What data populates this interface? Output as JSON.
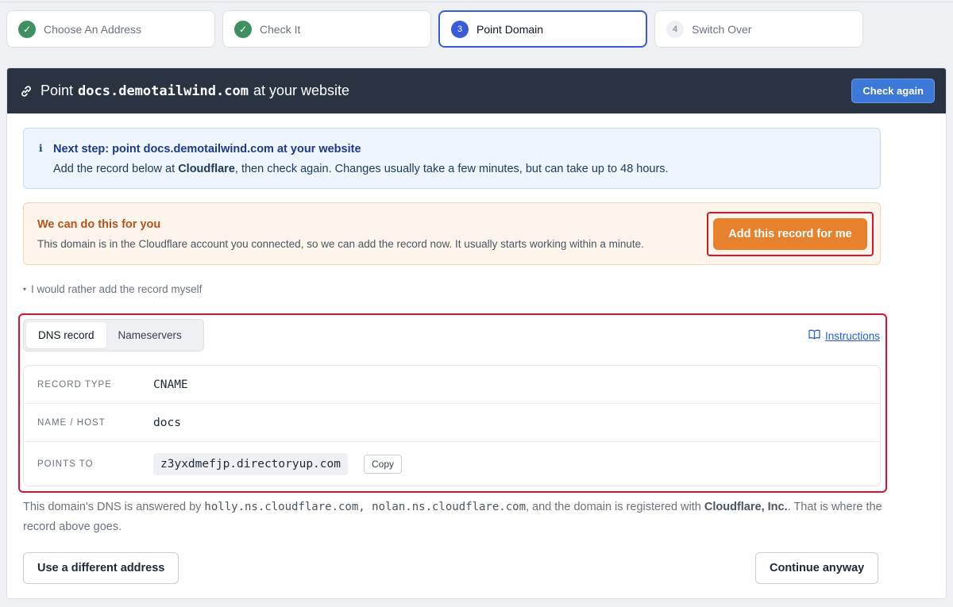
{
  "steps": [
    {
      "number": "✓",
      "label": "Choose An Address",
      "state": "done"
    },
    {
      "number": "✓",
      "label": "Check It",
      "state": "done"
    },
    {
      "number": "3",
      "label": "Point Domain",
      "state": "current"
    },
    {
      "number": "4",
      "label": "Switch Over",
      "state": "todo"
    }
  ],
  "header": {
    "prefix": "Point",
    "domain": "docs.demotailwind.com",
    "suffix": "at your website",
    "check_again_label": "Check again",
    "icon": "link-icon"
  },
  "info": {
    "icon_glyph": "i",
    "heading": "Next step: point docs.demotailwind.com at your website",
    "body_before": "Add the record below at ",
    "provider": "Cloudflare",
    "body_after": ", then check again. Changes usually take a few minutes, but can take up to 48 hours."
  },
  "offer": {
    "heading": "We can do this for you",
    "body": "This domain is in the Cloudflare account you connected, so we can add the record now. It usually starts working within a minute.",
    "button_label": "Add this record for me"
  },
  "manual_toggle": {
    "caret": "▾",
    "label": "I would rather add the record myself"
  },
  "dns": {
    "tabs": [
      {
        "label": "DNS record",
        "active": true
      },
      {
        "label": "Nameservers",
        "active": false
      }
    ],
    "instructions_label": "Instructions",
    "records": [
      {
        "label": "RECORD TYPE",
        "value": "CNAME"
      },
      {
        "label": "NAME / HOST",
        "value": "docs"
      },
      {
        "label": "POINTS TO",
        "value": "z3yxdmefjp.directoryup.com"
      }
    ],
    "copy_label": "Copy"
  },
  "note": {
    "before": "This domain's DNS is answered by ",
    "nameservers": "holly.ns.cloudflare.com, nolan.ns.cloudflare.com",
    "middle": ", and the domain is registered with ",
    "registrar": "Cloudflare, Inc.",
    "after": ". That is where the record above goes."
  },
  "footer": {
    "different_label": "Use a different address",
    "continue_label": "Continue anyway"
  },
  "colors": {
    "header_bg": "#2a3342",
    "accent_blue": "#3b78d8",
    "accent_orange": "#e8812e",
    "highlight_red": "#e0122a",
    "success_green": "#3f8f63"
  }
}
